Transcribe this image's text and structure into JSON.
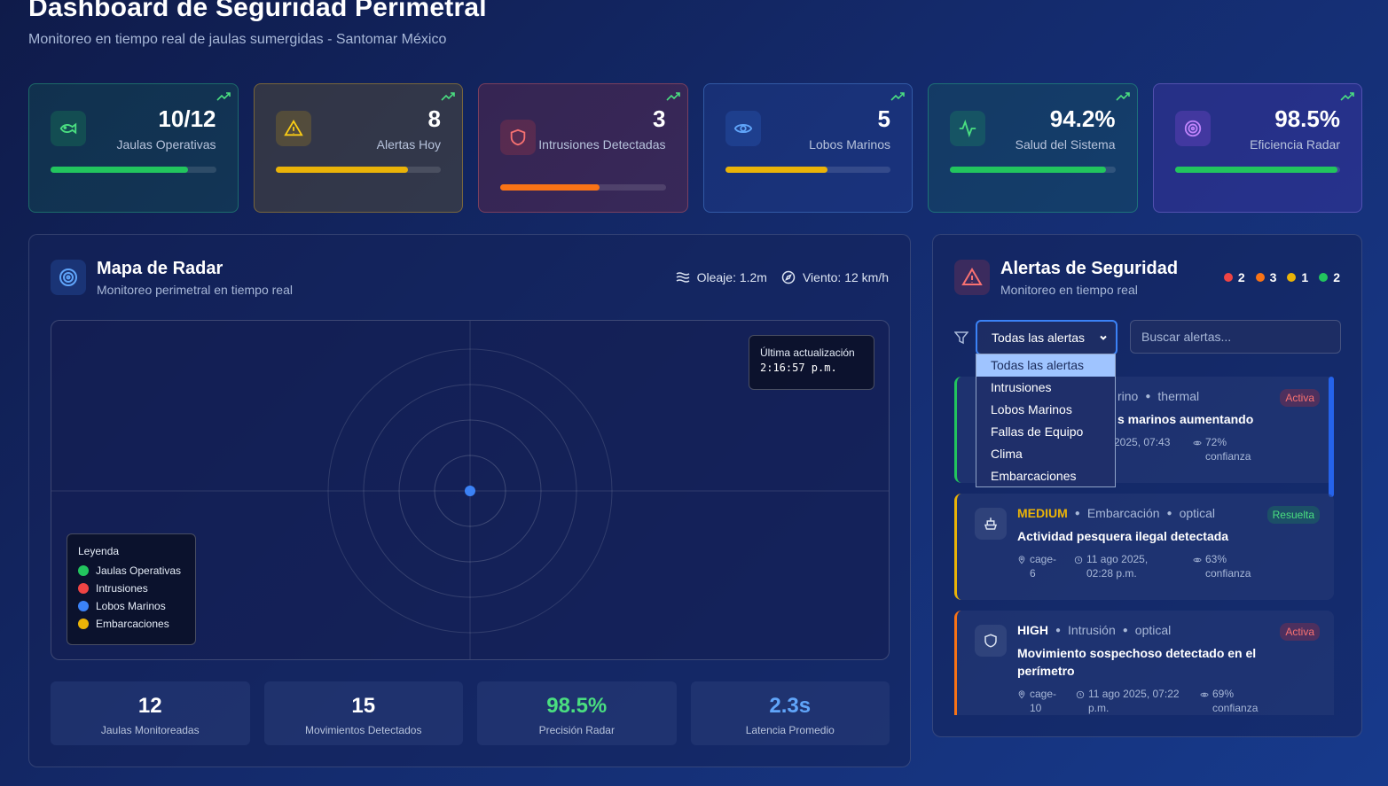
{
  "header": {
    "title": "Dashboard de Seguridad Perimetral",
    "subtitle": "Monitoreo en tiempo real de jaulas sumergidas - Santomar México"
  },
  "stats": [
    {
      "value": "10/12",
      "label": "Jaulas Operativas",
      "progress": 0.83,
      "color": "#22c55e",
      "icon": "fish-icon"
    },
    {
      "value": "8",
      "label": "Alertas Hoy",
      "progress": 0.8,
      "color": "#eab308",
      "icon": "warning-icon"
    },
    {
      "value": "3",
      "label": "Intrusiones Detectadas",
      "progress": 0.6,
      "color": "#f97316",
      "icon": "shield-icon"
    },
    {
      "value": "5",
      "label": "Lobos Marinos",
      "progress": 0.62,
      "color": "#eab308",
      "icon": "eye-icon"
    },
    {
      "value": "94.2%",
      "label": "Salud del Sistema",
      "progress": 0.942,
      "color": "#22c55e",
      "icon": "activity-icon"
    },
    {
      "value": "98.5%",
      "label": "Eficiencia Radar",
      "progress": 0.985,
      "color": "#22c55e",
      "icon": "radar-icon"
    }
  ],
  "radar": {
    "title": "Mapa de Radar",
    "subtitle": "Monitoreo perimetral en tiempo real",
    "waves": "Oleaje: 1.2m",
    "wind": "Viento: 12 km/h",
    "update_label": "Última actualización",
    "update_time": "2:16:57 p.m.",
    "legend_title": "Leyenda",
    "legend": [
      {
        "label": "Jaulas Operativas",
        "color": "#22c55e"
      },
      {
        "label": "Intrusiones",
        "color": "#ef4444"
      },
      {
        "label": "Lobos Marinos",
        "color": "#3b82f6"
      },
      {
        "label": "Embarcaciones",
        "color": "#eab308"
      }
    ],
    "metrics": [
      {
        "value": "12",
        "label": "Jaulas Monitoreadas",
        "color": "#ffffff"
      },
      {
        "value": "15",
        "label": "Movimientos Detectados",
        "color": "#ffffff"
      },
      {
        "value": "98.5%",
        "label": "Precisión Radar",
        "color": "#4ade80"
      },
      {
        "value": "2.3s",
        "label": "Latencia Promedio",
        "color": "#60a5fa"
      }
    ]
  },
  "alerts": {
    "title": "Alertas de Seguridad",
    "subtitle": "Monitoreo en tiempo real",
    "counts": [
      {
        "value": "2",
        "color": "#ef4444"
      },
      {
        "value": "3",
        "color": "#f97316"
      },
      {
        "value": "1",
        "color": "#eab308"
      },
      {
        "value": "2",
        "color": "#22c55e"
      }
    ],
    "filter_selected": "Todas las alertas",
    "filter_options": [
      "Todas las alertas",
      "Intrusiones",
      "Lobos Marinos",
      "Fallas de Equipo",
      "Clima",
      "Embarcaciones"
    ],
    "search_placeholder": "Buscar alertas...",
    "items": [
      {
        "type_partial": "rino",
        "sensor": "thermal",
        "title_partial": "s marinos aumentando",
        "date_partial": "2025, 07:43",
        "confidence": "72%",
        "confidence_label": "confianza",
        "status": "Activa",
        "border": "#22c55e"
      },
      {
        "severity": "MEDIUM",
        "severity_color": "#eab308",
        "type": "Embarcación",
        "sensor": "optical",
        "title": "Actividad pesquera ilegal detectada",
        "cage": "cage-",
        "cage_num": "6",
        "date": "11 ago 2025,",
        "time": "02:28 p.m.",
        "confidence": "63%",
        "confidence_label": "confianza",
        "status": "Resuelta",
        "border": "#eab308"
      },
      {
        "severity": "HIGH",
        "severity_color": "#ffffff",
        "type": "Intrusión",
        "sensor": "optical",
        "title": "Movimiento sospechoso detectado en el perímetro",
        "cage": "cage-",
        "cage_num": "10",
        "date": "11 ago 2025, 07:22",
        "time": "p.m.",
        "confidence": "69%",
        "confidence_label": "confianza",
        "status": "Activa",
        "border": "#f97316"
      }
    ]
  }
}
